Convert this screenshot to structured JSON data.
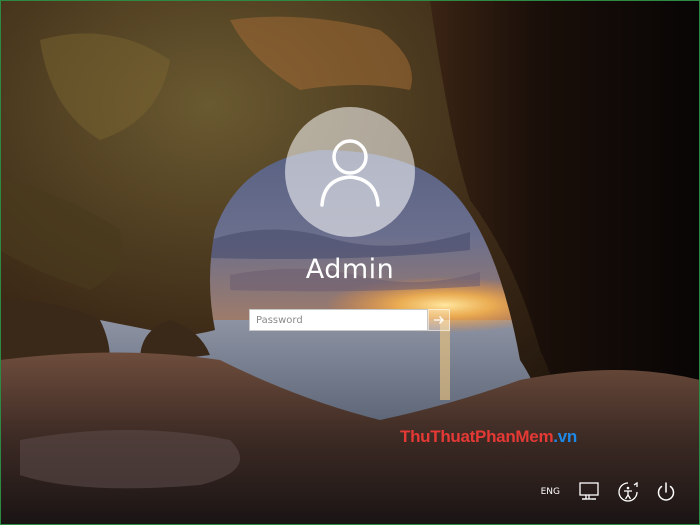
{
  "user": {
    "name": "Admin"
  },
  "password": {
    "placeholder": "Password",
    "value": ""
  },
  "tray": {
    "language": "ENG"
  },
  "watermark": {
    "thu": "Thu",
    "thuat": "Thuat",
    "phan": "Phan",
    "mem": "Mem",
    "vn": ".vn"
  },
  "icons": {
    "avatar": "user-silhouette-icon",
    "submit": "arrow-right-icon",
    "network": "network-icon",
    "ease_of_access": "ease-of-access-icon",
    "power": "power-icon"
  },
  "colors": {
    "watermark_red": "#e53935",
    "watermark_blue": "#1e88e5",
    "avatar_circle": "rgba(255,255,255,0.55)"
  }
}
